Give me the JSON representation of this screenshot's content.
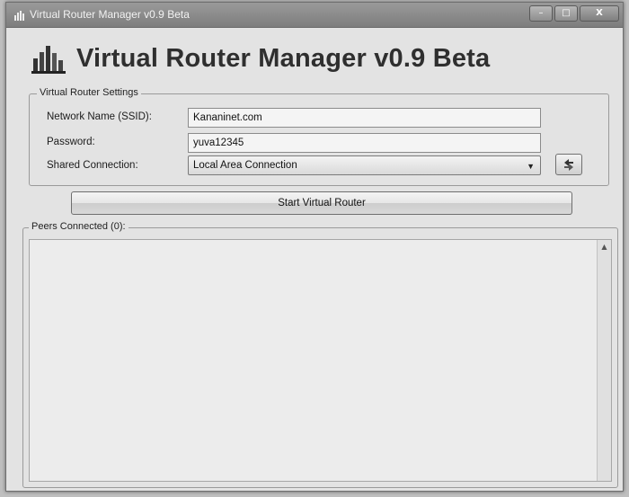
{
  "window": {
    "titlebar_text": "Virtual Router Manager v0.9 Beta",
    "minimize_glyph": "–",
    "maximize_glyph": "□",
    "close_glyph": "X"
  },
  "header": {
    "title": "Virtual Router Manager v0.9 Beta",
    "logo_icon": "router-logo-icon"
  },
  "settings": {
    "group_label": "Virtual Router Settings",
    "ssid_label": "Network Name (SSID):",
    "ssid_value": "Kananinet.com",
    "password_label": "Password:",
    "password_value": "yuva12345",
    "shared_label": "Shared Connection:",
    "shared_value": "Local Area Connection",
    "refresh_icon": "refresh-icon"
  },
  "actions": {
    "start_label": "Start Virtual Router"
  },
  "peers": {
    "group_label": "Peers Connected (0):"
  }
}
